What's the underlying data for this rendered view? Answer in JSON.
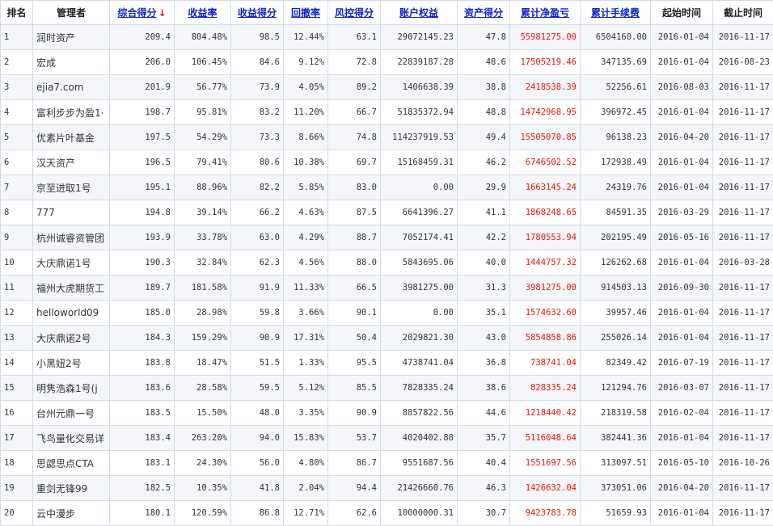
{
  "table": {
    "headers": [
      {
        "label": "排名",
        "link": false
      },
      {
        "label": "管理者",
        "link": false
      },
      {
        "label": "综合得分",
        "link": true,
        "sort_arrow": "↓"
      },
      {
        "label": "收益率",
        "link": true
      },
      {
        "label": "收益得分",
        "link": true
      },
      {
        "label": "回撤率",
        "link": true
      },
      {
        "label": "风控得分",
        "link": true
      },
      {
        "label": "账户权益",
        "link": true
      },
      {
        "label": "资产得分",
        "link": true
      },
      {
        "label": "累计净盈亏",
        "link": true
      },
      {
        "label": "累计手续费",
        "link": true
      },
      {
        "label": "起始时间",
        "link": false
      },
      {
        "label": "截止时间",
        "link": false
      }
    ],
    "rows": [
      {
        "rank": "1",
        "manager": "润时资产",
        "score": "209.4",
        "return_rate": "804.48%",
        "return_score": "98.5",
        "drawdown": "12.44%",
        "risk_score": "63.1",
        "equity": "29072145.23",
        "asset_score": "47.8",
        "net_pnl": "55981275.00",
        "fees": "6504160.00",
        "start": "2016-01-04",
        "end": "2016-11-17"
      },
      {
        "rank": "2",
        "manager": "宏成",
        "score": "206.0",
        "return_rate": "106.45%",
        "return_score": "84.6",
        "drawdown": "9.12%",
        "risk_score": "72.8",
        "equity": "22839187.28",
        "asset_score": "48.6",
        "net_pnl": "17505219.46",
        "fees": "347135.69",
        "start": "2016-01-04",
        "end": "2016-08-23"
      },
      {
        "rank": "3",
        "manager": "ejia7.com",
        "score": "201.9",
        "return_rate": "56.77%",
        "return_score": "73.9",
        "drawdown": "4.05%",
        "risk_score": "89.2",
        "equity": "1406638.39",
        "asset_score": "38.8",
        "net_pnl": "2418538.39",
        "fees": "52256.61",
        "start": "2016-08-03",
        "end": "2016-11-17"
      },
      {
        "rank": "4",
        "manager": "富利步步为盈1·",
        "score": "198.7",
        "return_rate": "95.81%",
        "return_score": "83.2",
        "drawdown": "11.20%",
        "risk_score": "66.7",
        "equity": "51835372.94",
        "asset_score": "48.8",
        "net_pnl": "14742968.95",
        "fees": "396972.45",
        "start": "2016-01-04",
        "end": "2016-11-17"
      },
      {
        "rank": "5",
        "manager": "优素片叶基金",
        "score": "197.5",
        "return_rate": "54.29%",
        "return_score": "73.3",
        "drawdown": "8.66%",
        "risk_score": "74.8",
        "equity": "114237919.53",
        "asset_score": "49.4",
        "net_pnl": "15505070.85",
        "fees": "96138.23",
        "start": "2016-04-20",
        "end": "2016-11-17"
      },
      {
        "rank": "6",
        "manager": "汉天资产",
        "score": "196.5",
        "return_rate": "79.41%",
        "return_score": "80.6",
        "drawdown": "10.38%",
        "risk_score": "69.7",
        "equity": "15168459.31",
        "asset_score": "46.2",
        "net_pnl": "6746502.52",
        "fees": "172938.49",
        "start": "2016-01-04",
        "end": "2016-11-17"
      },
      {
        "rank": "7",
        "manager": "京至进取1号",
        "score": "195.1",
        "return_rate": "88.96%",
        "return_score": "82.2",
        "drawdown": "5.85%",
        "risk_score": "83.0",
        "equity": "0.00",
        "asset_score": "29.9",
        "net_pnl": "1663145.24",
        "fees": "24319.76",
        "start": "2016-01-04",
        "end": "2016-11-17"
      },
      {
        "rank": "8",
        "manager": "777",
        "score": "194.8",
        "return_rate": "39.14%",
        "return_score": "66.2",
        "drawdown": "4.63%",
        "risk_score": "87.5",
        "equity": "6641396.27",
        "asset_score": "41.1",
        "net_pnl": "1868248.65",
        "fees": "84591.35",
        "start": "2016-03-29",
        "end": "2016-11-17"
      },
      {
        "rank": "9",
        "manager": "杭州诚睿资管团",
        "score": "193.9",
        "return_rate": "33.78%",
        "return_score": "63.0",
        "drawdown": "4.29%",
        "risk_score": "88.7",
        "equity": "7052174.41",
        "asset_score": "42.2",
        "net_pnl": "1780553.94",
        "fees": "202195.49",
        "start": "2016-05-16",
        "end": "2016-11-17"
      },
      {
        "rank": "10",
        "manager": "大庆鼎诺1号",
        "score": "190.3",
        "return_rate": "32.84%",
        "return_score": "62.3",
        "drawdown": "4.56%",
        "risk_score": "88.0",
        "equity": "5843695.06",
        "asset_score": "40.0",
        "net_pnl": "1444757.32",
        "fees": "126262.68",
        "start": "2016-01-04",
        "end": "2016-03-28"
      },
      {
        "rank": "11",
        "manager": "福州大虎期货工",
        "score": "189.7",
        "return_rate": "181.58%",
        "return_score": "91.9",
        "drawdown": "11.33%",
        "risk_score": "66.5",
        "equity": "3981275.00",
        "asset_score": "31.3",
        "net_pnl": "3981275.00",
        "fees": "914503.13",
        "start": "2016-09-30",
        "end": "2016-11-17"
      },
      {
        "rank": "12",
        "manager": "helloworld09",
        "score": "185.0",
        "return_rate": "28.98%",
        "return_score": "59.8",
        "drawdown": "3.66%",
        "risk_score": "90.1",
        "equity": "0.00",
        "asset_score": "35.1",
        "net_pnl": "1574632.60",
        "fees": "39957.46",
        "start": "2016-01-04",
        "end": "2016-11-17"
      },
      {
        "rank": "13",
        "manager": "大庆鼎诺2号",
        "score": "184.3",
        "return_rate": "159.29%",
        "return_score": "90.9",
        "drawdown": "17.31%",
        "risk_score": "50.4",
        "equity": "2029821.30",
        "asset_score": "43.0",
        "net_pnl": "5854858.86",
        "fees": "255026.14",
        "start": "2016-01-04",
        "end": "2016-11-17"
      },
      {
        "rank": "14",
        "manager": "小黑妞2号",
        "score": "183.8",
        "return_rate": "18.47%",
        "return_score": "51.5",
        "drawdown": "1.33%",
        "risk_score": "95.5",
        "equity": "4738741.04",
        "asset_score": "36.8",
        "net_pnl": "738741.04",
        "fees": "82349.42",
        "start": "2016-07-19",
        "end": "2016-11-17"
      },
      {
        "rank": "15",
        "manager": "明隽浩森1号(j",
        "score": "183.6",
        "return_rate": "28.58%",
        "return_score": "59.5",
        "drawdown": "5.12%",
        "risk_score": "85.5",
        "equity": "7828335.24",
        "asset_score": "38.6",
        "net_pnl": "828335.24",
        "fees": "121294.76",
        "start": "2016-03-07",
        "end": "2016-11-17"
      },
      {
        "rank": "16",
        "manager": "台州元鼎一号",
        "score": "183.5",
        "return_rate": "15.50%",
        "return_score": "48.0",
        "drawdown": "3.35%",
        "risk_score": "90.9",
        "equity": "8857822.56",
        "asset_score": "44.6",
        "net_pnl": "1218440.42",
        "fees": "218319.58",
        "start": "2016-02-04",
        "end": "2016-11-17"
      },
      {
        "rank": "17",
        "manager": "飞鸟量化交易详",
        "score": "183.4",
        "return_rate": "263.20%",
        "return_score": "94.0",
        "drawdown": "15.83%",
        "risk_score": "53.7",
        "equity": "4020402.88",
        "asset_score": "35.7",
        "net_pnl": "5116048.64",
        "fees": "382441.36",
        "start": "2016-01-04",
        "end": "2016-11-17"
      },
      {
        "rank": "18",
        "manager": "思勰思点CTA",
        "score": "183.1",
        "return_rate": "24.30%",
        "return_score": "56.0",
        "drawdown": "4.80%",
        "risk_score": "86.7",
        "equity": "9551687.56",
        "asset_score": "40.4",
        "net_pnl": "1551697.56",
        "fees": "313097.51",
        "start": "2016-05-10",
        "end": "2016-10-26"
      },
      {
        "rank": "19",
        "manager": "重剑无锋99",
        "score": "182.5",
        "return_rate": "10.35%",
        "return_score": "41.8",
        "drawdown": "2.04%",
        "risk_score": "94.4",
        "equity": "21426660.76",
        "asset_score": "46.3",
        "net_pnl": "1426632.04",
        "fees": "373051.06",
        "start": "2016-04-20",
        "end": "2016-11-17"
      },
      {
        "rank": "20",
        "manager": "云中漫步",
        "score": "180.1",
        "return_rate": "120.59%",
        "return_score": "86.8",
        "drawdown": "12.71%",
        "risk_score": "62.6",
        "equity": "10000000.31",
        "asset_score": "30.7",
        "net_pnl": "9423783.78",
        "fees": "51659.93",
        "start": "2016-01-04",
        "end": "2016-11-17"
      }
    ]
  },
  "colors": {
    "link": "#0b25c8",
    "sort_arrow": "#e8160c",
    "pnl_text": "#e8160c",
    "row_stripe": "#f4f6f9",
    "border": "#d4dbe6"
  }
}
